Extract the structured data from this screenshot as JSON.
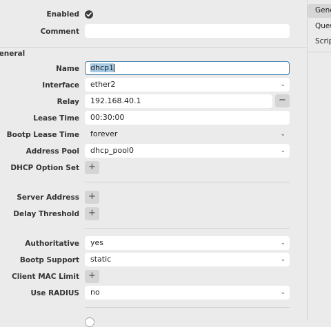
{
  "form": {
    "enabled_label": "Enabled",
    "comment_label": "Comment",
    "comment_value": "",
    "section_label": "General",
    "name_label": "Name",
    "name_value": "dhcp1",
    "interface_label": "Interface",
    "interface_value": "ether2",
    "relay_label": "Relay",
    "relay_value": "192.168.40.1",
    "lease_time_label": "Lease Time",
    "lease_time_value": "00:30:00",
    "bootp_lease_label": "Bootp Lease Time",
    "bootp_lease_value": "forever",
    "address_pool_label": "Address Pool",
    "address_pool_value": "dhcp_pool0",
    "option_set_label": "DHCP Option Set",
    "server_address_label": "Server Address",
    "delay_threshold_label": "Delay Threshold",
    "authoritative_label": "Authoritative",
    "authoritative_value": "yes",
    "bootp_support_label": "Bootp Support",
    "bootp_support_value": "static",
    "client_mac_label": "Client MAC Limit",
    "use_radius_label": "Use RADIUS",
    "use_radius_value": "no"
  },
  "sidebar": {
    "items": [
      {
        "label": "General"
      },
      {
        "label": "Queues"
      },
      {
        "label": "Script"
      }
    ]
  },
  "icons": {
    "plus": "+",
    "minus": "−",
    "chevron": "⌄"
  }
}
